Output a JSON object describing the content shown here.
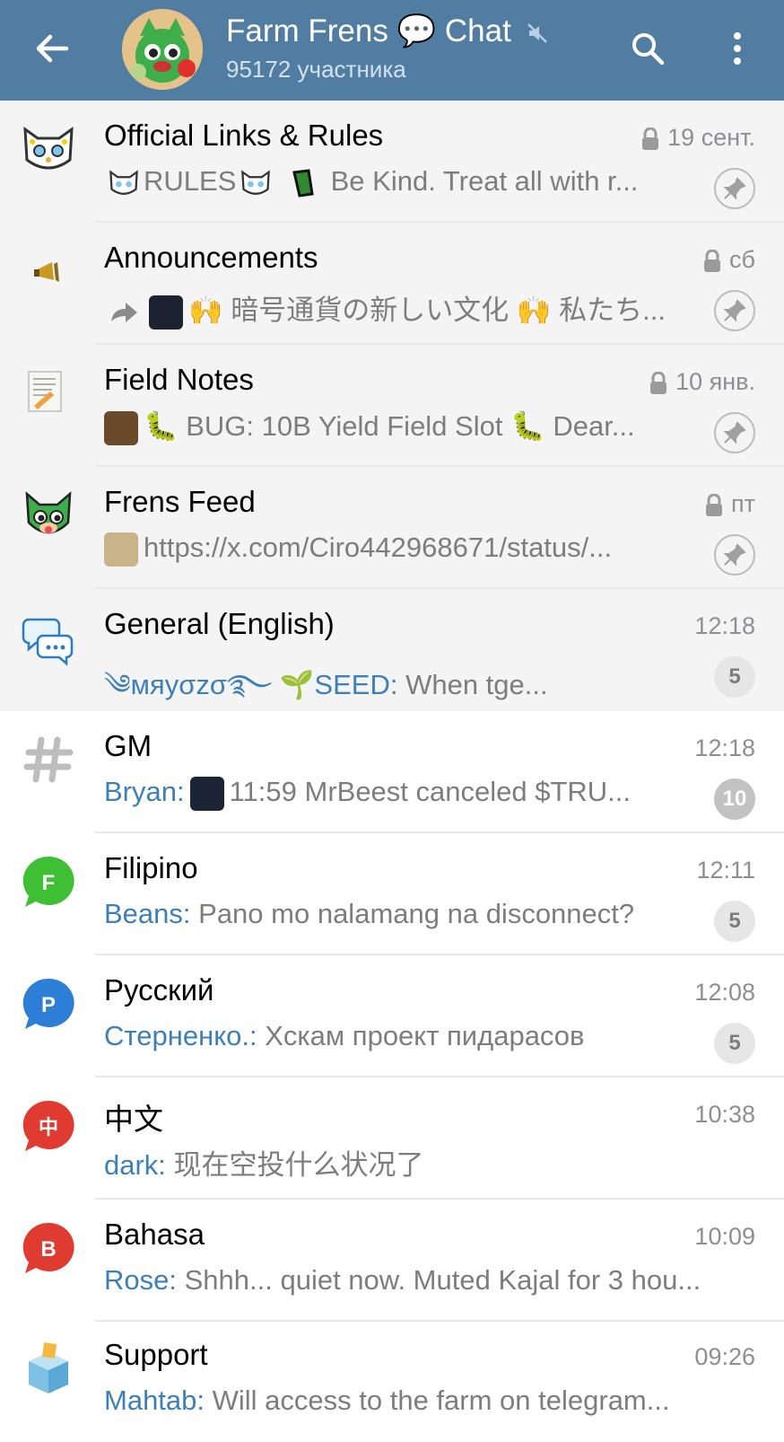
{
  "header": {
    "title": "Farm Frens 💬 Chat",
    "subtitle": "95172 участника"
  },
  "chats": [
    {
      "title": "Official Links & Rules",
      "time": "19 сент.",
      "locked": true,
      "pinned": true,
      "sender": "",
      "preview": "RULES",
      "preview2": "Be Kind. Treat all with r..."
    },
    {
      "title": "Announcements",
      "time": "сб",
      "locked": true,
      "pinned": true,
      "sender": "",
      "preview": "暗号通貨の新しい文化",
      "preview2": "私たち..."
    },
    {
      "title": "Field Notes",
      "time": "10 янв.",
      "locked": true,
      "pinned": true,
      "sender": "",
      "preview": "BUG: 10B Yield Field Slot",
      "preview2": "Dear..."
    },
    {
      "title": "Frens Feed",
      "time": "пт",
      "locked": true,
      "pinned": true,
      "sender": "",
      "preview": "https://x.com/Ciro442968671/status/..."
    },
    {
      "title": "General (English)",
      "time": "12:18",
      "sender": "мяуσzσ",
      "sender_tail": "🌱SEED:",
      "preview": "When tge...",
      "badge": "5"
    },
    {
      "title": "GM",
      "time": "12:18",
      "sender": "Bryan:",
      "preview": "11:59 MrBeest canceled $TRU...",
      "badge": "10"
    },
    {
      "title": "Filipino",
      "time": "12:11",
      "sender": "Beans:",
      "preview": "Pano mo nalamang na disconnect?",
      "badge": "5"
    },
    {
      "title": "Русский",
      "time": "12:08",
      "sender": "Стерненко.:",
      "preview": "Хскам проект пидарасов",
      "badge": "5"
    },
    {
      "title": "中文",
      "time": "10:38",
      "sender": "dark:",
      "preview": "现在空投什么状况了"
    },
    {
      "title": "Bahasa",
      "time": "10:09",
      "sender": "Rose:",
      "preview": "Shhh... quiet now. Muted Kajal for 3 hou..."
    },
    {
      "title": "Support",
      "time": "09:26",
      "sender": "Mahtab:",
      "preview": "Will access to the farm on telegram..."
    }
  ],
  "icons": {
    "filipino_letter": "F",
    "russian_letter": "P",
    "chinese_letter": "中",
    "bahasa_letter": "B",
    "green": "#3fbf34",
    "blue": "#2d7ed6",
    "red": "#e03b30",
    "header_bg": "#527da3",
    "link_color": "#3d7fb7"
  }
}
